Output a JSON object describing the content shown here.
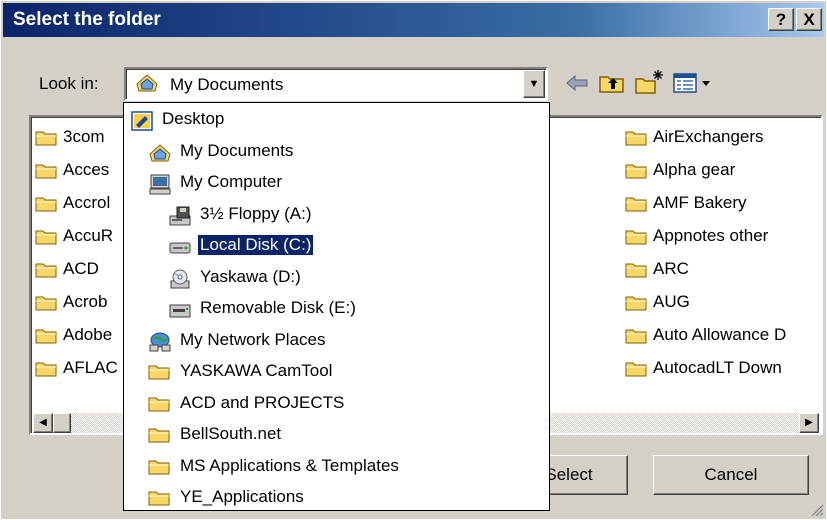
{
  "window": {
    "title": "Select the folder",
    "help_label": "?",
    "close_label": "X"
  },
  "lookin": {
    "label": "Look in:",
    "value": "My Documents"
  },
  "listview": {
    "left_items": [
      "3com",
      "Acces",
      "Accrol",
      "AccuR",
      "ACD",
      "Acrob",
      "Adobe",
      "AFLAC"
    ],
    "right_items": [
      "AirExchangers",
      "Alpha gear",
      "AMF Bakery",
      "Appnotes other",
      "ARC",
      "AUG",
      "Auto Allowance D",
      "AutocadLT Down"
    ]
  },
  "dropdown": {
    "items": [
      {
        "label": "Desktop",
        "icon": "desktop-icon",
        "selected": false
      },
      {
        "label": "My Documents",
        "icon": "my-documents-icon",
        "selected": false
      },
      {
        "label": "My Computer",
        "icon": "my-computer-icon",
        "selected": false
      },
      {
        "label": "3½ Floppy (A:)",
        "icon": "floppy-drive-icon",
        "selected": false
      },
      {
        "label": "Local Disk (C:)",
        "icon": "hard-disk-icon",
        "selected": true
      },
      {
        "label": "Yaskawa (D:)",
        "icon": "cd-drive-icon",
        "selected": false
      },
      {
        "label": "Removable Disk (E:)",
        "icon": "removable-disk-icon",
        "selected": false
      },
      {
        "label": "My Network Places",
        "icon": "network-places-icon",
        "selected": false
      },
      {
        "label": "YASKAWA CamTool",
        "icon": "folder-icon",
        "selected": false
      },
      {
        "label": "ACD and PROJECTS",
        "icon": "folder-icon",
        "selected": false
      },
      {
        "label": "BellSouth.net",
        "icon": "folder-icon",
        "selected": false
      },
      {
        "label": "MS Applications & Templates",
        "icon": "folder-icon",
        "selected": false
      },
      {
        "label": "YE_Applications",
        "icon": "folder-icon",
        "selected": false
      }
    ]
  },
  "buttons": {
    "select_label": "Select",
    "cancel_label": "Cancel"
  },
  "colors": {
    "title_bar": "#0a246a",
    "face": "#d4d0c8",
    "selection": "#0a246a",
    "folder": "#f7d768"
  }
}
